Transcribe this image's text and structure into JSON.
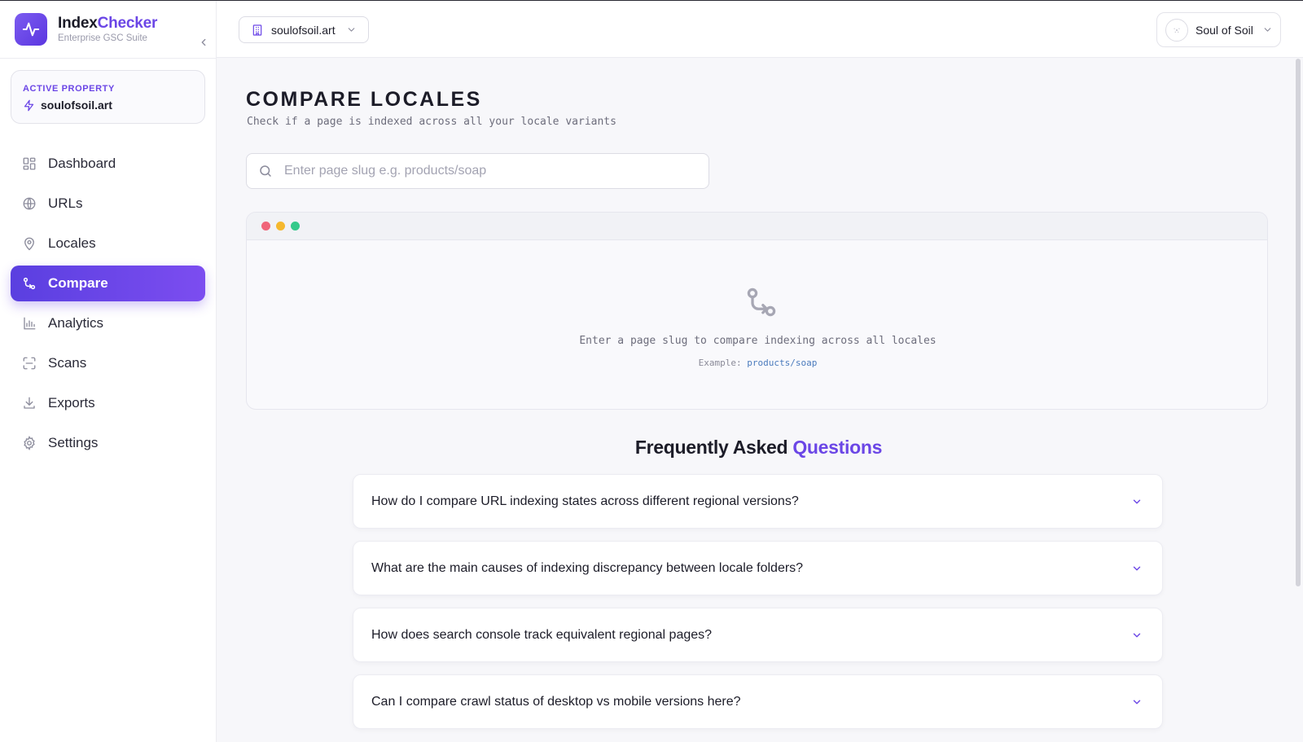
{
  "brand": {
    "name_part1": "Index",
    "name_part2": "Checker",
    "subtitle": "Enterprise GSC Suite"
  },
  "active_property": {
    "label": "ACTIVE PROPERTY",
    "value": "soulofsoil.art"
  },
  "sidebar": {
    "items": [
      {
        "label": "Dashboard",
        "icon": "dashboard-grid-icon",
        "active": false
      },
      {
        "label": "URLs",
        "icon": "globe-icon",
        "active": false
      },
      {
        "label": "Locales",
        "icon": "map-pin-icon",
        "active": false
      },
      {
        "label": "Compare",
        "icon": "git-compare-icon",
        "active": true
      },
      {
        "label": "Analytics",
        "icon": "bar-chart-icon",
        "active": false
      },
      {
        "label": "Scans",
        "icon": "scan-icon",
        "active": false
      },
      {
        "label": "Exports",
        "icon": "download-icon",
        "active": false
      },
      {
        "label": "Settings",
        "icon": "gear-icon",
        "active": false
      }
    ]
  },
  "header": {
    "property_selector": "soulofsoil.art",
    "user_name": "Soul of Soil"
  },
  "main": {
    "title": "COMPARE LOCALES",
    "subtitle": "Check if a page is indexed across all your locale variants",
    "search_placeholder": "Enter page slug e.g. products/soap",
    "empty_state": {
      "message": "Enter a page slug to compare indexing across all locales",
      "example_label": "Example:",
      "example_value": "products/soap"
    },
    "faq": {
      "title_part1": "Frequently Asked",
      "title_part2": "Questions",
      "items": [
        "How do I compare URL indexing states across different regional versions?",
        "What are the main causes of indexing discrepancy between locale folders?",
        "How does search console track equivalent regional pages?",
        "Can I compare crawl status of desktop vs mobile versions here?"
      ]
    }
  },
  "colors": {
    "accent": "#6b46e6",
    "window_dot_red": "#f0657a",
    "window_dot_yellow": "#f5b82e",
    "window_dot_green": "#34c98a"
  }
}
